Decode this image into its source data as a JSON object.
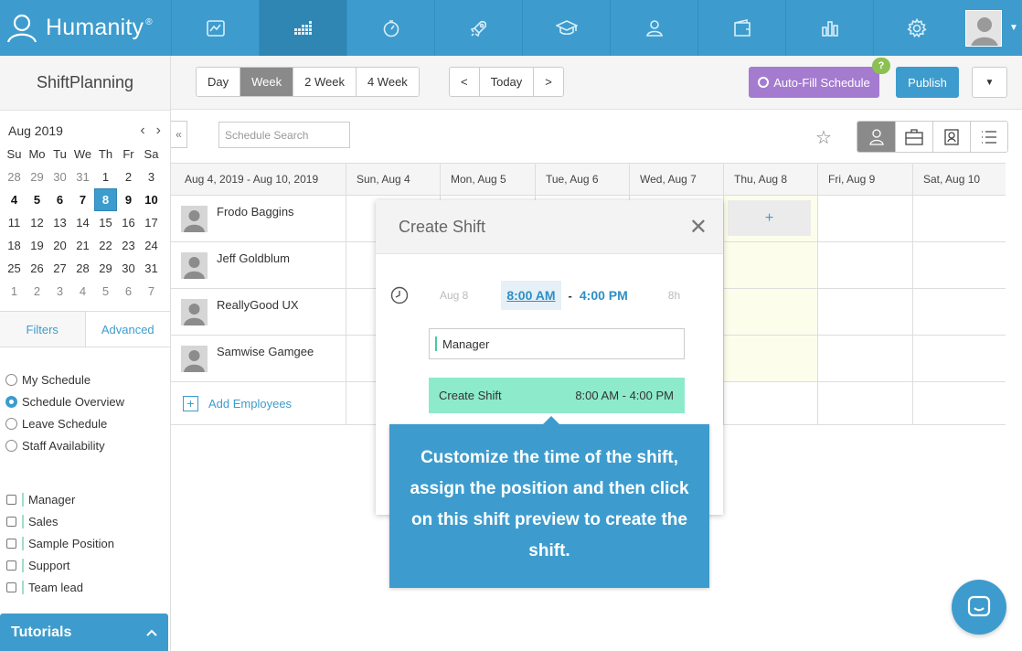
{
  "brand": {
    "name": "Humanity",
    "reg": "®"
  },
  "sidebar": {
    "title": "ShiftPlanning",
    "calendar": {
      "month": "Aug 2019",
      "weekdays": [
        "Su",
        "Mo",
        "Tu",
        "We",
        "Th",
        "Fr",
        "Sa"
      ],
      "days": [
        "28",
        "29",
        "30",
        "31",
        "1",
        "2",
        "3",
        "4",
        "5",
        "6",
        "7",
        "8",
        "9",
        "10",
        "11",
        "12",
        "13",
        "14",
        "15",
        "16",
        "17",
        "18",
        "19",
        "20",
        "21",
        "22",
        "23",
        "24",
        "25",
        "26",
        "27",
        "28",
        "29",
        "30",
        "31",
        "1",
        "2",
        "3",
        "4",
        "5",
        "6",
        "7"
      ],
      "selected": "8"
    },
    "tabs": {
      "filters": "Filters",
      "advanced": "Advanced"
    },
    "schedules": [
      "My Schedule",
      "Schedule Overview",
      "Leave Schedule",
      "Staff Availability"
    ],
    "positions": [
      "Manager",
      "Sales",
      "Sample Position",
      "Support",
      "Team lead"
    ],
    "tutorials": "Tutorials"
  },
  "toolbar": {
    "ranges": [
      "Day",
      "Week",
      "2 Week",
      "4 Week"
    ],
    "nav": {
      "prev": "<",
      "today": "Today",
      "next": ">"
    },
    "autofill": "Auto-Fill Schedule",
    "help_badge": "?",
    "publish": "Publish"
  },
  "search": {
    "placeholder": "Schedule Search"
  },
  "grid": {
    "range_label": "Aug 4, 2019 - Aug 10, 2019",
    "days": [
      "Sun, Aug 4",
      "Mon, Aug 5",
      "Tue, Aug 6",
      "Wed, Aug 7",
      "Thu, Aug 8",
      "Fri, Aug 9",
      "Sat, Aug 10"
    ],
    "employees": [
      "Frodo Baggins",
      "Jeff Goldblum",
      "ReallyGood UX",
      "Samwise Gamgee"
    ],
    "add_employees": "Add Employees",
    "add_shift": "+"
  },
  "modal": {
    "title": "Create Shift",
    "date": "Aug 8",
    "start": "8:00 AM",
    "separator": "-",
    "end": "4:00 PM",
    "hours": "8h",
    "position": "Manager",
    "preview_label": "Create Shift",
    "preview_time": "8:00 AM - 4:00 PM"
  },
  "tooltip": "Customize the time of the shift, assign the position and then click on this shift preview to create the shift."
}
